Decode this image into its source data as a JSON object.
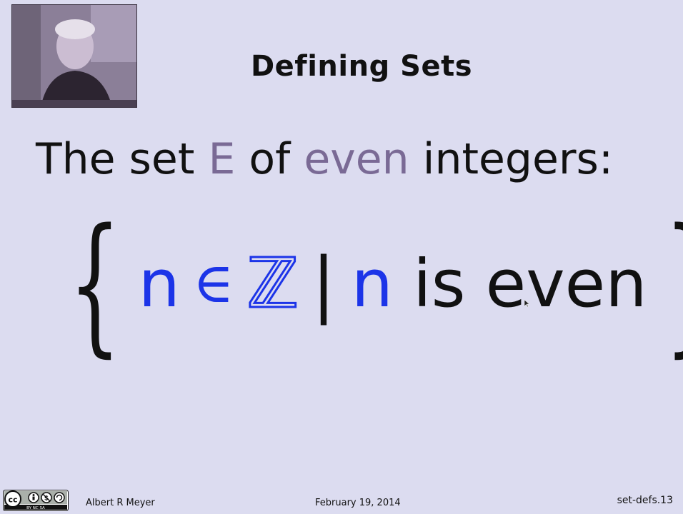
{
  "slide": {
    "title": "Defining Sets",
    "subtitle": {
      "prefix": "The set ",
      "set_name": "E",
      "middle": " of ",
      "even_word": "even",
      "suffix": " integers:"
    },
    "set_builder": {
      "left_brace": "{",
      "var": "n",
      "element_of": "∈",
      "integers": "ℤ",
      "bar": "|",
      "var2": "n",
      "predicate_is": "is",
      "predicate_even": "even",
      "right_brace": "}"
    }
  },
  "footer": {
    "license_icon": "creative-commons-by-nc-sa-icon",
    "license_text": "BY NC SA",
    "author": "Albert R Meyer",
    "date": "February 19, 2014",
    "slide_id": "set-defs.13"
  },
  "colors": {
    "background": "#dcdcf0",
    "highlight_purple": "#7a6a95",
    "math_blue": "#1c34e8",
    "text": "#111111"
  }
}
